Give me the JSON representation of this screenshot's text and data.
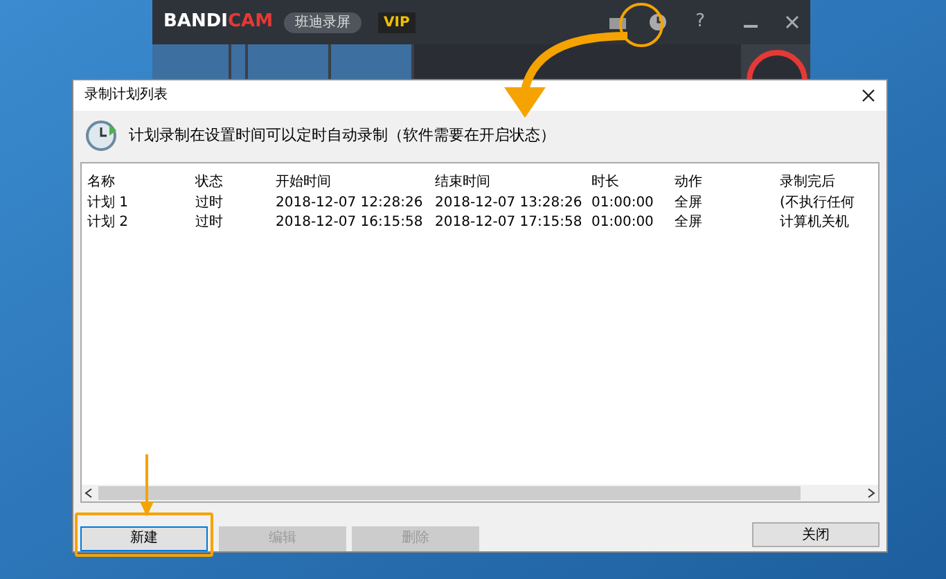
{
  "app": {
    "logo_first": "BANDI",
    "logo_second": "CAM",
    "product": "班迪录屏",
    "badge": "VIP",
    "help": "?"
  },
  "dialog": {
    "title": "录制计划列表",
    "description": "计划录制在设置时间可以定时自动录制（软件需要在开启状态）",
    "columns": [
      "名称",
      "状态",
      "开始时间",
      "结束时间",
      "时长",
      "动作",
      "录制完后"
    ],
    "rows": [
      {
        "cells": [
          "计划 1",
          "过时",
          "2018-12-07 12:28:26",
          "2018-12-07 13:28:26",
          "01:00:00",
          "全屏",
          "(不执行任何"
        ]
      },
      {
        "cells": [
          "计划 2",
          "过时",
          "2018-12-07 16:15:58",
          "2018-12-07 17:15:58",
          "01:00:00",
          "全屏",
          "计算机关机"
        ]
      }
    ],
    "buttons": [
      {
        "label": "新建",
        "disabled": false,
        "highlighted": true
      },
      {
        "label": "编辑",
        "disabled": true,
        "highlighted": false
      },
      {
        "label": "删除",
        "disabled": true,
        "highlighted": false
      }
    ],
    "close_button": "关闭"
  }
}
